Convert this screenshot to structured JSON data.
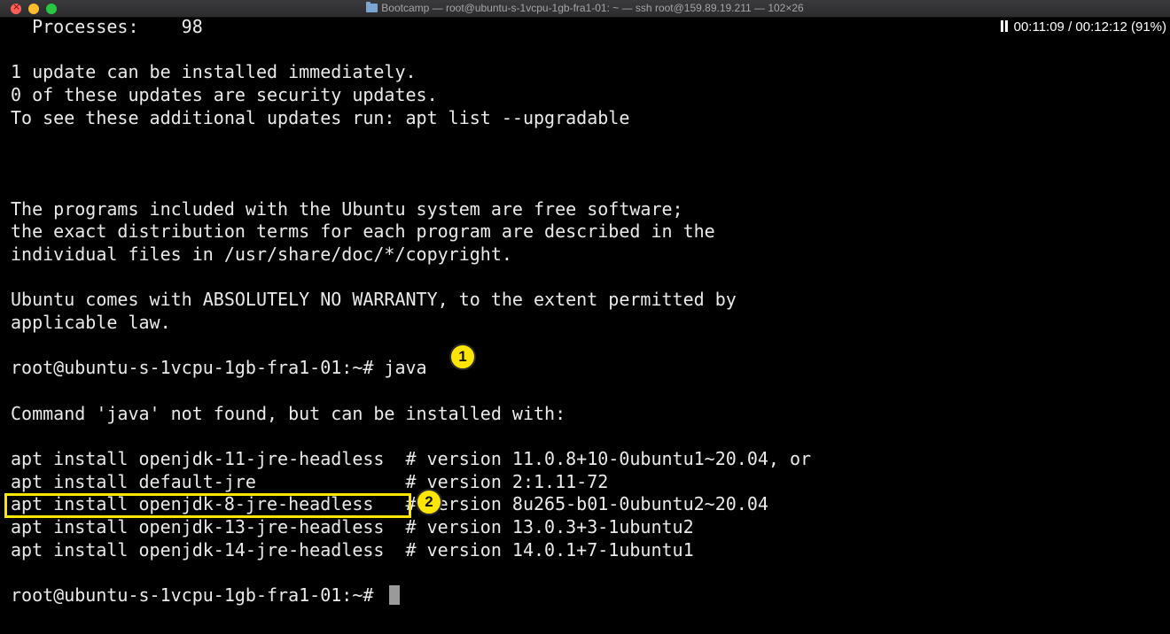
{
  "window": {
    "title": "Bootcamp — root@ubuntu-s-1vcpu-1gb-fra1-01: ~ — ssh root@159.89.19.211 — 102×26"
  },
  "player": {
    "elapsed": "00:11:09",
    "separator": "/",
    "total": "00:12:12",
    "percent": "(91%)"
  },
  "terminal": {
    "lines": [
      "  Processes:    98",
      "",
      "1 update can be installed immediately.",
      "0 of these updates are security updates.",
      "To see these additional updates run: apt list --upgradable",
      "",
      "",
      "",
      "The programs included with the Ubuntu system are free software;",
      "the exact distribution terms for each program are described in the",
      "individual files in /usr/share/doc/*/copyright.",
      "",
      "Ubuntu comes with ABSOLUTELY NO WARRANTY, to the extent permitted by",
      "applicable law.",
      "",
      "root@ubuntu-s-1vcpu-1gb-fra1-01:~# java",
      "",
      "Command 'java' not found, but can be installed with:",
      "",
      "apt install openjdk-11-jre-headless  # version 11.0.8+10-0ubuntu1~20.04, or",
      "apt install default-jre              # version 2:1.11-72",
      "apt install openjdk-8-jre-headless   # version 8u265-b01-0ubuntu2~20.04",
      "apt install openjdk-13-jre-headless  # version 13.0.3+3-1ubuntu2",
      "apt install openjdk-14-jre-headless  # version 14.0.1+7-1ubuntu1",
      "",
      "root@ubuntu-s-1vcpu-1gb-fra1-01:~# "
    ]
  },
  "annotations": {
    "badge1": "1",
    "badge2": "2"
  },
  "colors": {
    "terminal_bg": "#000000",
    "terminal_fg": "#eaeaea",
    "annotation_yellow": "#ffe600"
  }
}
